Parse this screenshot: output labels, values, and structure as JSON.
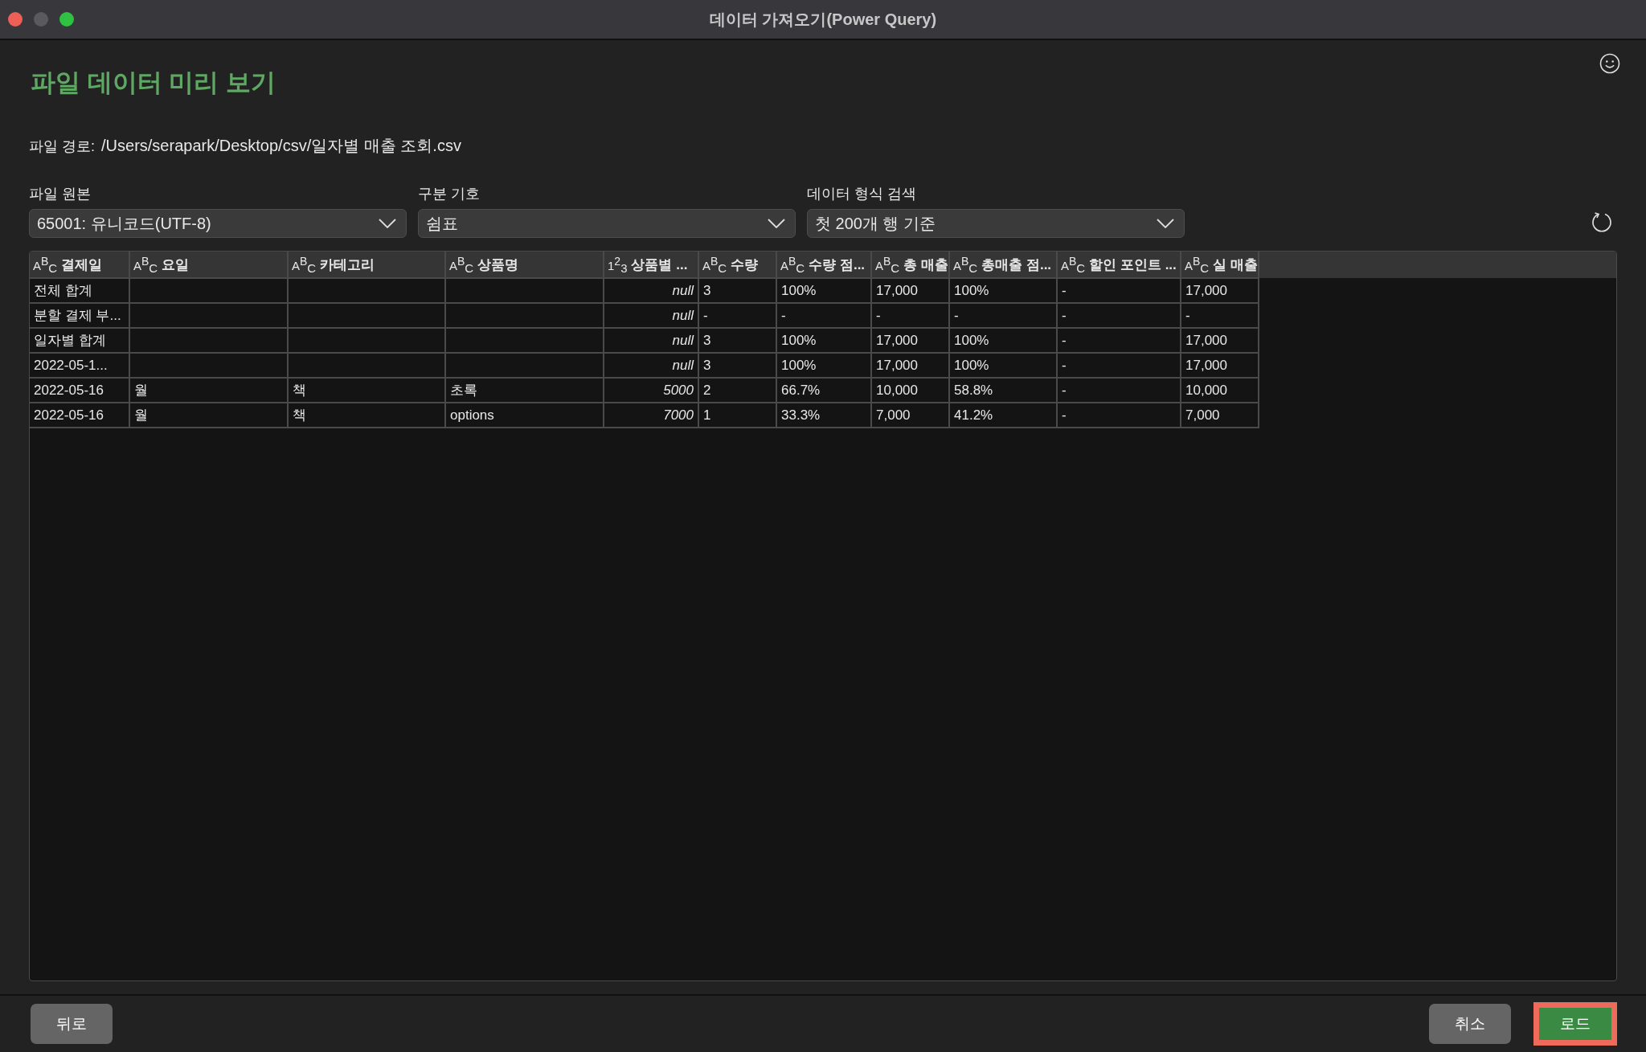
{
  "window": {
    "title": "데이터 가져오기(Power Query)"
  },
  "heading": "파일 데이터 미리 보기",
  "file_path": {
    "label": "파일 경로:",
    "value": "/Users/serapark/Desktop/csv/일자별 매출 조회.csv"
  },
  "dropdowns": [
    {
      "label": "파일 원본",
      "value": "65001: 유니코드(UTF-8)"
    },
    {
      "label": "구분 기호",
      "value": "쉼표"
    },
    {
      "label": "데이터 형식 검색",
      "value": "첫 200개 행 기준"
    }
  ],
  "table": {
    "columns": [
      {
        "name": "결제일",
        "kind": "text",
        "type_glyphs": [
          "A",
          "B",
          "C"
        ]
      },
      {
        "name": "요일",
        "kind": "text",
        "type_glyphs": [
          "A",
          "B",
          "C"
        ]
      },
      {
        "name": "카테고리",
        "kind": "text",
        "type_glyphs": [
          "A",
          "B",
          "C"
        ]
      },
      {
        "name": "상품명",
        "kind": "text",
        "type_glyphs": [
          "A",
          "B",
          "C"
        ]
      },
      {
        "name": "상품별 ...",
        "kind": "number",
        "type_glyphs": [
          "1",
          "2",
          "3"
        ]
      },
      {
        "name": "수량",
        "kind": "text",
        "type_glyphs": [
          "A",
          "B",
          "C"
        ]
      },
      {
        "name": "수량 점...",
        "kind": "text",
        "type_glyphs": [
          "A",
          "B",
          "C"
        ]
      },
      {
        "name": "총 매출",
        "kind": "text",
        "type_glyphs": [
          "A",
          "B",
          "C"
        ]
      },
      {
        "name": "총매출 점...",
        "kind": "text",
        "type_glyphs": [
          "A",
          "B",
          "C"
        ]
      },
      {
        "name": "할인 포인트 ...",
        "kind": "text",
        "type_glyphs": [
          "A",
          "B",
          "C"
        ]
      },
      {
        "name": "실 매출",
        "kind": "text",
        "type_glyphs": [
          "A",
          "B",
          "C"
        ]
      }
    ],
    "rows": [
      [
        "전체 합계",
        "",
        "",
        "",
        "null",
        "3",
        "100%",
        "17,000",
        "100%",
        "-",
        "17,000"
      ],
      [
        "분할 결제 부...",
        "",
        "",
        "",
        "null",
        "-",
        "-",
        "-",
        "-",
        "-",
        "-"
      ],
      [
        "일자별 합계",
        "",
        "",
        "",
        "null",
        "3",
        "100%",
        "17,000",
        "100%",
        "-",
        "17,000"
      ],
      [
        "2022-05-1...",
        "",
        "",
        "",
        "null",
        "3",
        "100%",
        "17,000",
        "100%",
        "-",
        "17,000"
      ],
      [
        "2022-05-16",
        "월",
        "책",
        "초록",
        "5000",
        "2",
        "66.7%",
        "10,000",
        "58.8%",
        "-",
        "10,000"
      ],
      [
        "2022-05-16",
        "월",
        "책",
        "options",
        "7000",
        "1",
        "33.3%",
        "7,000",
        "41.2%",
        "-",
        "7,000"
      ]
    ]
  },
  "buttons": [
    {
      "label": "뒤로",
      "kind": "secondary",
      "highlighted": false
    },
    {
      "label": "취소",
      "kind": "secondary",
      "highlighted": false
    },
    {
      "label": "로드",
      "kind": "primary",
      "highlighted": true
    }
  ]
}
